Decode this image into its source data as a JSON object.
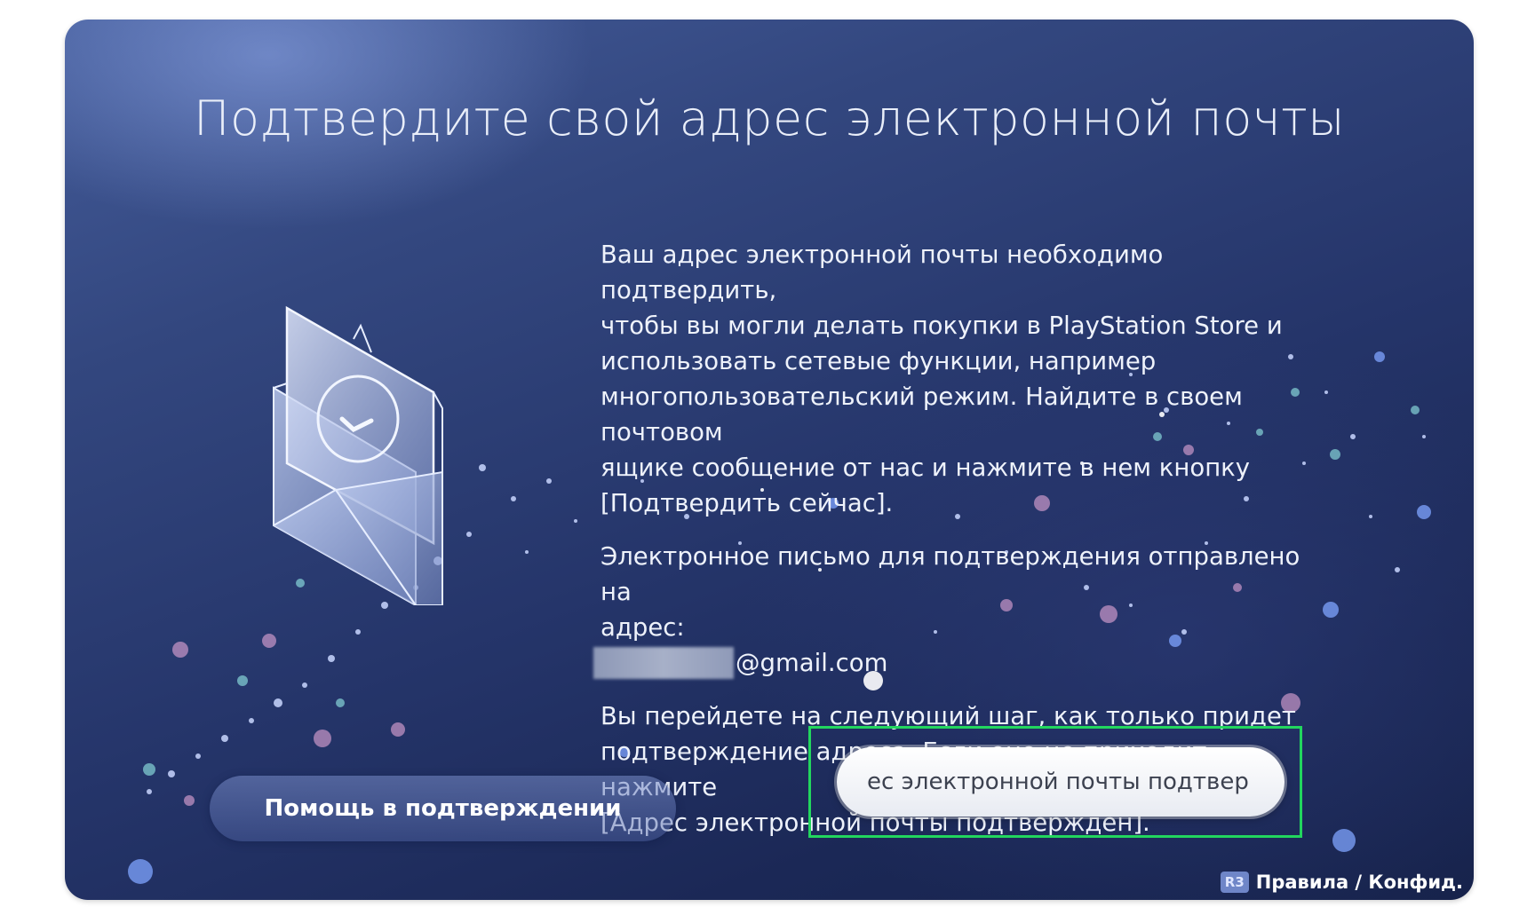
{
  "page": {
    "title": "Подтвердите свой адрес электронной почты"
  },
  "content": {
    "paragraph_1": [
      "Ваш адрес электронной почты необходимо подтвердить,",
      "чтобы вы могли делать покупки в PlayStation Store и",
      "использовать сетевые функции, например",
      "многопользовательский режим. Найдите в своем почтовом",
      "ящике сообщение от нас и нажмите в нем кнопку",
      "[Подтвердить сейчас]."
    ],
    "paragraph_2": [
      "Электронное письмо для подтверждения отправлено на",
      "адрес:"
    ],
    "email_suffix": "@gmail.com",
    "paragraph_3": [
      "Вы перейдете на следующий шаг, как только придет",
      "подтверждение адреса. Если оно не приходит, нажмите",
      "[Адрес электронной почты подтвержден]."
    ]
  },
  "buttons": {
    "help_label": "Помощь в подтверждении",
    "confirm_label": "ес электронной почты подтвер"
  },
  "footer": {
    "badge": "R3",
    "label": "Правила / Конфид."
  },
  "icons": {
    "envelope": "envelope-check-icon"
  },
  "colors": {
    "highlight": "#22d65e"
  }
}
